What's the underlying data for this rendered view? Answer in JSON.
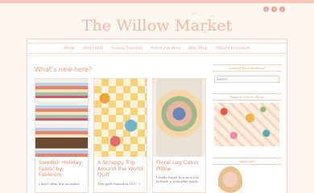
{
  "site": {
    "title": "The Willow Market"
  },
  "social": [
    {
      "icon": "instagram-icon",
      "glyph": "◎"
    },
    {
      "icon": "facebook-icon",
      "glyph": "f"
    },
    {
      "icon": "pinterest-icon",
      "glyph": "p"
    }
  ],
  "nav": {
    "items": [
      "Home",
      "About Kelli",
      "Sewing Tutorials",
      "Where I've Been",
      "Etsy Shop",
      "Affiliate Disclosure"
    ]
  },
  "main": {
    "heading": "What's new here?",
    "posts": [
      {
        "title": "Swedish Holiday Fabric by Fableism",
        "excerpt": "I don't often buy an entire"
      },
      {
        "title": "A Scrappy Trip Around the World Quilt",
        "excerpt": "This quilt started in 2017. I"
      },
      {
        "title": "Floral Log Cabin Pillow",
        "excerpt": "I really forget how nice it is to finish a somewhat quick"
      }
    ]
  },
  "sidebar": {
    "search_title": "Looking for something?",
    "search_placeholder": "Search ...",
    "shop_title": "Favorite Fabric Shops",
    "about_title": "Meet Kelli"
  },
  "colors": {
    "accent": "#e89d84",
    "background": "#fdf6f1"
  }
}
